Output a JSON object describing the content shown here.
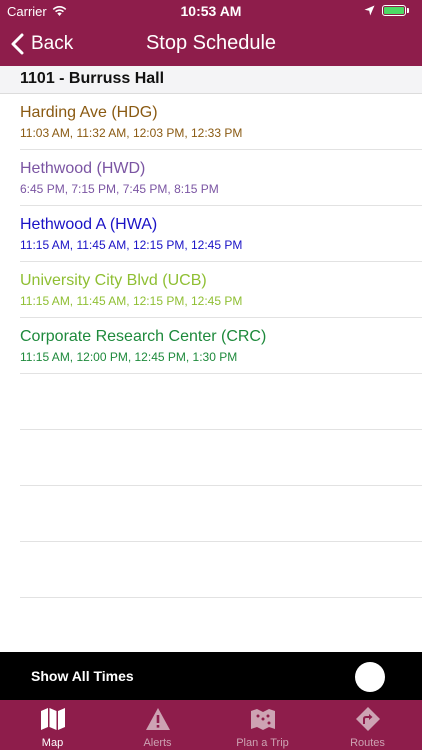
{
  "status_bar": {
    "carrier": "Carrier",
    "time": "10:53 AM"
  },
  "nav": {
    "back_label": "Back",
    "title": "Stop Schedule"
  },
  "stop": {
    "title": "1101 - Burruss Hall"
  },
  "routes": [
    {
      "name": "Harding Ave (HDG)",
      "times": "11:03 AM, 11:32 AM, 12:03 PM, 12:33 PM",
      "color": "#8a5a12"
    },
    {
      "name": "Hethwood (HWD)",
      "times": "6:45 PM, 7:15 PM, 7:45 PM, 8:15 PM",
      "color": "#7b55a3"
    },
    {
      "name": "Hethwood A (HWA)",
      "times": "11:15 AM, 11:45 AM, 12:15 PM, 12:45 PM",
      "color": "#1a12c6"
    },
    {
      "name": "University City Blvd (UCB)",
      "times": "11:15 AM, 11:45 AM, 12:15 PM, 12:45 PM",
      "color": "#8fbf33"
    },
    {
      "name": "Corporate Research Center (CRC)",
      "times": "11:15 AM, 12:00 PM, 12:45 PM, 1:30 PM",
      "color": "#1e8a3c"
    }
  ],
  "empty_rows": 5,
  "toggle": {
    "label": "Show All Times",
    "on": false
  },
  "tabs": [
    {
      "label": "Map",
      "icon": "map-icon",
      "active": true
    },
    {
      "label": "Alerts",
      "icon": "alert-icon",
      "active": false
    },
    {
      "label": "Plan a Trip",
      "icon": "plan-trip-icon",
      "active": false
    },
    {
      "label": "Routes",
      "icon": "routes-icon",
      "active": false
    }
  ],
  "colors": {
    "brand": "#8e1d4b",
    "toggle_bar": "#000000",
    "tab_inactive": "#cda3b3",
    "battery": "#4cd964"
  }
}
